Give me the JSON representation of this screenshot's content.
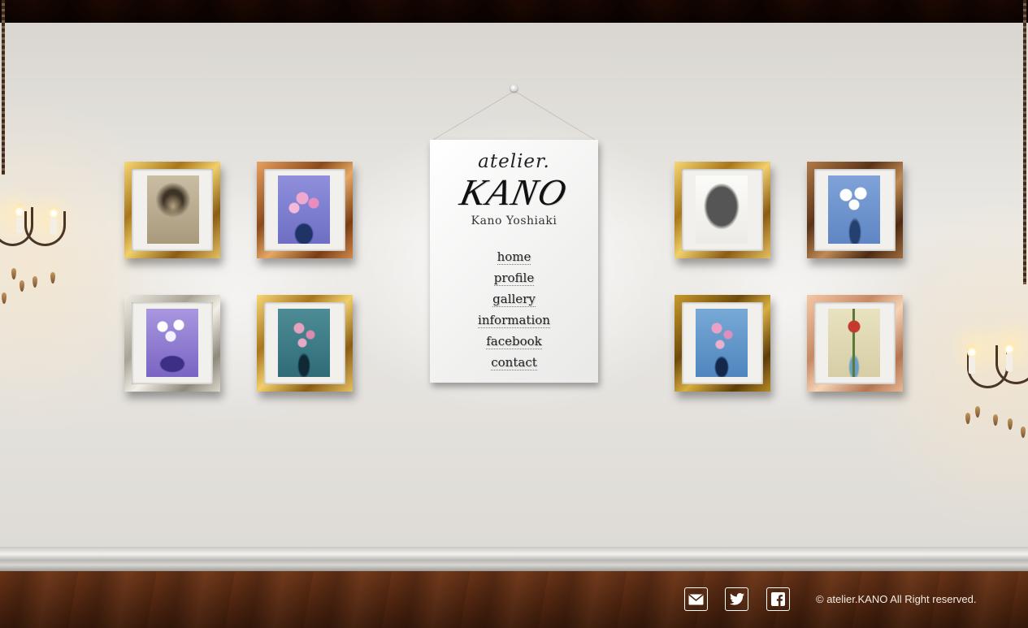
{
  "site": {
    "logo_top": "atelier.",
    "logo_main": "KANO",
    "artist_name": "Kano Yoshiaki"
  },
  "nav": {
    "items": [
      {
        "label": "home"
      },
      {
        "label": "profile"
      },
      {
        "label": "gallery"
      },
      {
        "label": "information"
      },
      {
        "label": "facebook"
      },
      {
        "label": "contact"
      }
    ]
  },
  "gallery": {
    "paintings": [
      {
        "subject": "portrait",
        "frame": "gold"
      },
      {
        "subject": "pink orchids in blue vase",
        "frame": "copper"
      },
      {
        "subject": "sketch of seated figure",
        "frame": "gold"
      },
      {
        "subject": "white flowers in blue vase",
        "frame": "bronze"
      },
      {
        "subject": "white orchids purple bouquet",
        "frame": "silver"
      },
      {
        "subject": "pink orchids teal vase",
        "frame": "gold"
      },
      {
        "subject": "pink orchids blue vase",
        "frame": "dark-gold"
      },
      {
        "subject": "red rose in vase",
        "frame": "pink-gold"
      }
    ]
  },
  "footer": {
    "icons": [
      "mail-icon",
      "twitter-icon",
      "facebook-icon"
    ],
    "copyright": "© atelier.KANO All Right reserved."
  },
  "colors": {
    "wall": "#e7e4df",
    "wood": "#4a2814",
    "panel": "#f5f5f4",
    "text": "#222222"
  }
}
